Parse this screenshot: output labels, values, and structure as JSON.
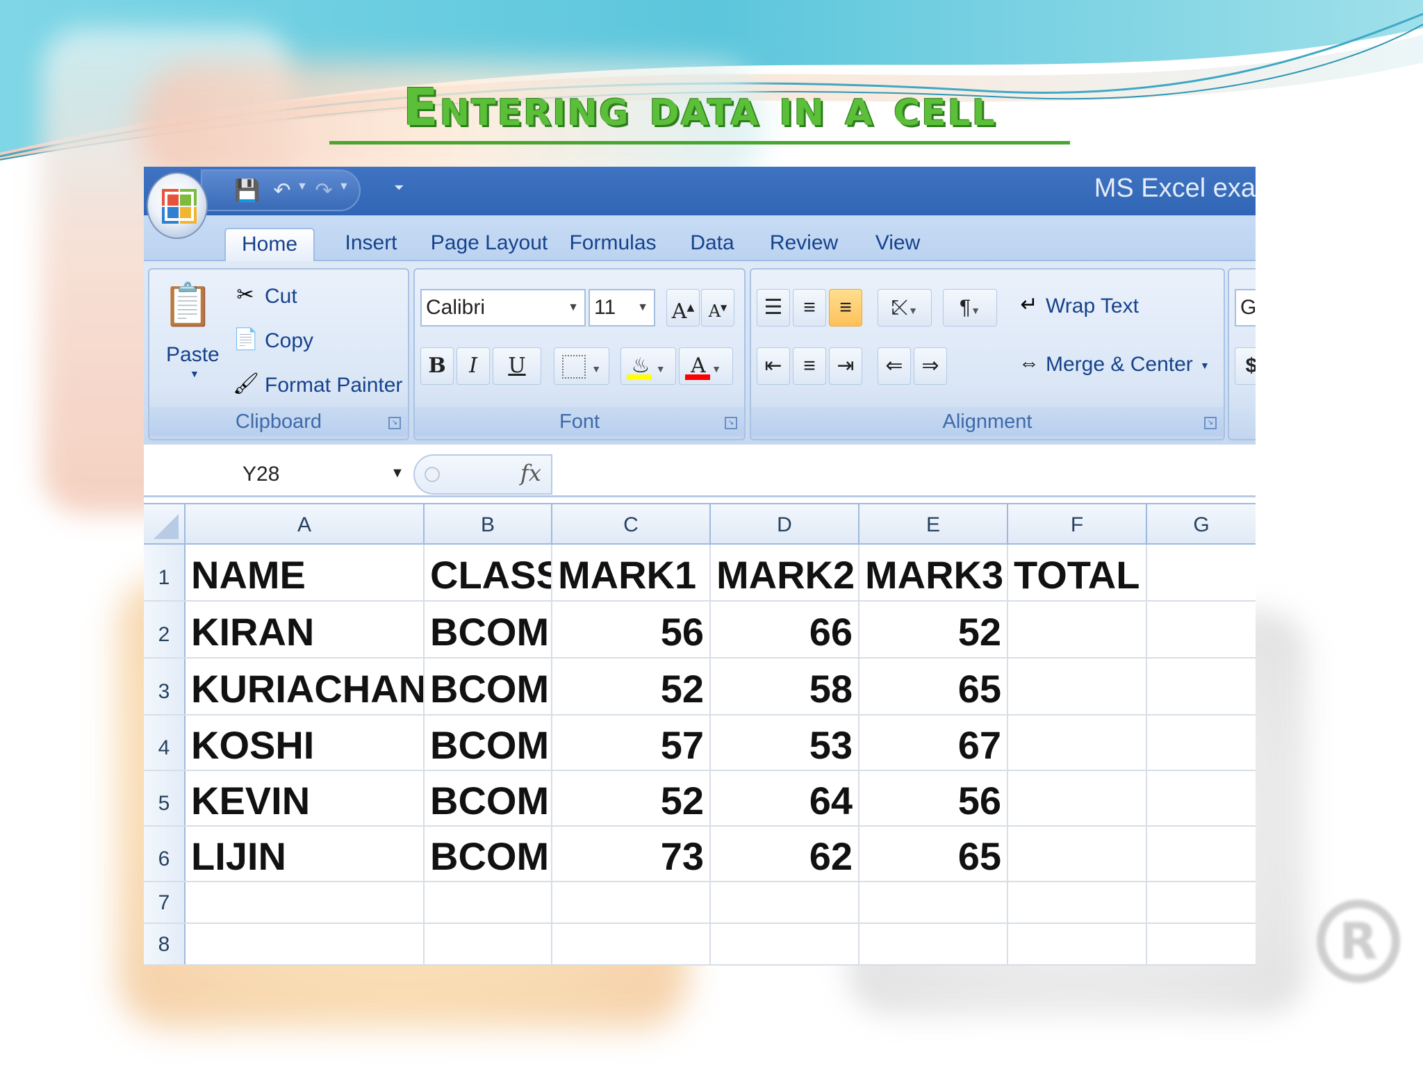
{
  "slide": {
    "title": "Entering data in a cell"
  },
  "window": {
    "title": "MS Excel exa"
  },
  "ribbon_tabs": [
    "Home",
    "Insert",
    "Page Layout",
    "Formulas",
    "Data",
    "Review",
    "View"
  ],
  "clipboard": {
    "paste": "Paste",
    "cut": "Cut",
    "copy": "Copy",
    "format_painter": "Format Painter",
    "label": "Clipboard"
  },
  "font": {
    "name": "Calibri",
    "size": "11",
    "label": "Font",
    "bold": "B",
    "italic": "I",
    "underline": "U"
  },
  "alignment": {
    "wrap_text": "Wrap Text",
    "merge_center": "Merge & Center",
    "label": "Alignment"
  },
  "number_partial": {
    "format": "Ge",
    "currency": "$"
  },
  "formula_bar": {
    "name_box": "Y28",
    "fx": "fx",
    "value": ""
  },
  "sheet": {
    "columns": [
      "A",
      "B",
      "C",
      "D",
      "E",
      "F",
      "G"
    ],
    "rows": [
      {
        "num": "1",
        "cells": [
          "NAME",
          "CLASS",
          "MARK1",
          "MARK2",
          "MARK3",
          "TOTAL",
          ""
        ]
      },
      {
        "num": "2",
        "cells": [
          "KIRAN",
          "BCOM",
          "56",
          "66",
          "52",
          "",
          ""
        ]
      },
      {
        "num": "3",
        "cells": [
          "KURIACHAN",
          "BCOM",
          "52",
          "58",
          "65",
          "",
          ""
        ]
      },
      {
        "num": "4",
        "cells": [
          "KOSHI",
          "BCOM",
          "57",
          "53",
          "67",
          "",
          ""
        ]
      },
      {
        "num": "5",
        "cells": [
          "KEVIN",
          "BCOM",
          "52",
          "64",
          "56",
          "",
          ""
        ]
      },
      {
        "num": "6",
        "cells": [
          "LIJIN",
          "BCOM",
          "73",
          "62",
          "65",
          "",
          ""
        ]
      },
      {
        "num": "7",
        "cells": [
          "",
          "",
          "",
          "",
          "",
          "",
          ""
        ]
      },
      {
        "num": "8",
        "cells": [
          "",
          "",
          "",
          "",
          "",
          "",
          ""
        ]
      }
    ]
  },
  "colors": {
    "title_green": "#5bbf3a",
    "titlebar_blue": "#3066b5",
    "ribbon_text": "#15428b"
  }
}
